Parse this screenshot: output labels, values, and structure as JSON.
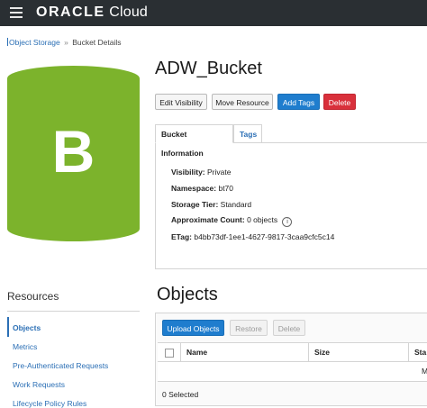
{
  "header": {
    "logo_brand": "ORACLE",
    "logo_product": "Cloud"
  },
  "breadcrumb": {
    "parent": "Object Storage",
    "separator": "»",
    "current": "Bucket Details"
  },
  "bucket": {
    "icon_letter": "B",
    "icon_color": "#7cb32c",
    "title": "ADW_Bucket"
  },
  "actions": {
    "edit_visibility": "Edit Visibility",
    "move_resource": "Move Resource",
    "add_tags": "Add Tags",
    "delete": "Delete"
  },
  "tabs": [
    {
      "label": "Bucket Information"
    },
    {
      "label": "Tags"
    }
  ],
  "info": {
    "visibility_label": "Visibility:",
    "visibility_value": "Private",
    "namespace_label": "Namespace:",
    "namespace_value": "bt70",
    "storage_tier_label": "Storage Tier:",
    "storage_tier_value": "Standard",
    "approx_count_label": "Approximate Count:",
    "approx_count_value": "0 objects",
    "info_icon": "i",
    "etag_label": "ETag:",
    "etag_value": "b4bb73df-1ee1-4627-9817-3caa9cfc5c14"
  },
  "resources": {
    "title": "Resources",
    "items": [
      {
        "label": "Objects"
      },
      {
        "label": "Metrics"
      },
      {
        "label": "Pre-Authenticated Requests"
      },
      {
        "label": "Work Requests"
      },
      {
        "label": "Lifecycle Policy Rules"
      }
    ]
  },
  "objects": {
    "title": "Objects",
    "upload_button": "Upload Objects",
    "restore_button": "Restore",
    "delete_button": "Delete",
    "columns": [
      "Name",
      "Size",
      "Sta"
    ],
    "row_partial": "M",
    "selected_text": "0 Selected"
  }
}
